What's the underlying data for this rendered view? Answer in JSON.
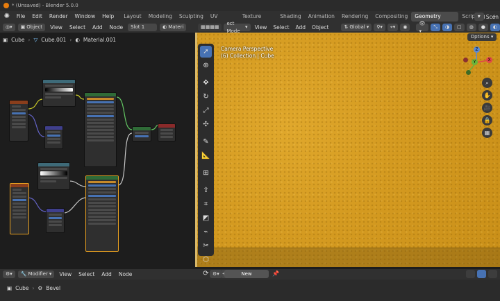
{
  "app": {
    "title": "* (Unsaved) - Blender 5.0.0"
  },
  "menu": {
    "items": [
      "File",
      "Edit",
      "Render",
      "Window",
      "Help"
    ]
  },
  "workspaces": [
    {
      "label": "Layout",
      "active": false
    },
    {
      "label": "Modeling",
      "active": false
    },
    {
      "label": "Sculpting",
      "active": false
    },
    {
      "label": "UV Editing",
      "active": false
    },
    {
      "label": "Texture Paint",
      "active": false
    },
    {
      "label": "Shading",
      "active": false
    },
    {
      "label": "Animation",
      "active": false
    },
    {
      "label": "Rendering",
      "active": false
    },
    {
      "label": "Compositing",
      "active": false
    },
    {
      "label": "Geometry Nodes",
      "active": true
    },
    {
      "label": "Scripting",
      "active": false
    }
  ],
  "workspace_add": "+",
  "scene_label": "Scen",
  "shader_editor": {
    "mode": "Object",
    "menus": [
      "View",
      "Select",
      "Add",
      "Node"
    ],
    "slot": "Slot 1",
    "material": "Materi",
    "breadcrumb": [
      "Cube",
      "Cube.001",
      "Material.001"
    ]
  },
  "viewport": {
    "mode": "ect Mode",
    "menus": [
      "View",
      "Select",
      "Add",
      "Object"
    ],
    "orientation": "Global",
    "options_label": "Options",
    "info": [
      "Camera Perspective",
      "(6) Collection | Cube"
    ],
    "gizmo_axes": [
      "Z",
      "Y",
      "X"
    ]
  },
  "geometry_editor": {
    "mode": "Modifier",
    "menus": [
      "View",
      "Select",
      "Add",
      "Node"
    ],
    "new_label": "New",
    "breadcrumb": [
      "Cube",
      "Bevel"
    ]
  },
  "icons": {
    "blender": "blender-logo-icon",
    "tools": [
      "select-box-icon",
      "cursor-icon",
      "move-icon",
      "rotate-icon",
      "scale-icon",
      "transform-icon",
      "annotate-icon",
      "measure-icon",
      "add-cube-icon",
      "extrude-icon",
      "inset-icon",
      "bevel-icon",
      "loop-cut-icon",
      "knife-icon",
      "poly-build-icon",
      "spin-icon"
    ]
  },
  "colors": {
    "accent": "#4772b3",
    "active_orange": "#e8a020",
    "viewport_object": "#d49a20"
  }
}
